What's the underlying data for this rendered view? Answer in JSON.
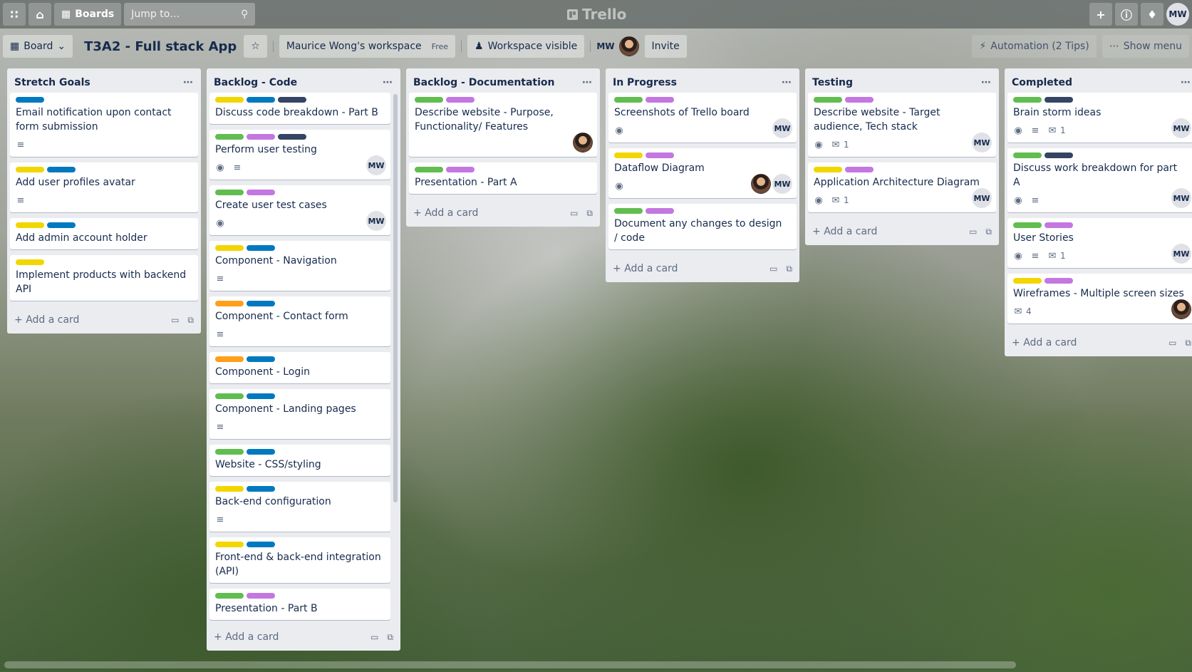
{
  "nav": {
    "boards_label": "Boards",
    "jump_placeholder": "Jump to…",
    "logo_text": "Trello",
    "user_initials": "MW"
  },
  "board": {
    "view_label": "Board",
    "title": "T3A2 - Full stack App",
    "workspace": "Maurice Wong's workspace",
    "plan": "Free",
    "visibility": "Workspace visible",
    "member_initials": "MW",
    "invite_label": "Invite",
    "automation_label": "Automation (2 Tips)",
    "show_menu_label": "Show menu"
  },
  "add_card_label": "Add a card",
  "lists": [
    {
      "title": "Stretch Goals",
      "cards": [
        {
          "labels": [
            "blue"
          ],
          "title": "Email notification upon contact form submission",
          "badges": {
            "desc": true
          }
        },
        {
          "labels": [
            "yellow",
            "blue"
          ],
          "title": "Add user profiles avatar",
          "badges": {
            "desc": true
          }
        },
        {
          "labels": [
            "yellow",
            "blue"
          ],
          "title": "Add admin account holder",
          "badges": {}
        },
        {
          "labels": [
            "yellow"
          ],
          "title": "Implement products with backend API",
          "badges": {}
        }
      ]
    },
    {
      "title": "Backlog - Code",
      "cards": [
        {
          "labels": [
            "yellow",
            "blue",
            "navy"
          ],
          "title": "Discuss code breakdown - Part B",
          "badges": {}
        },
        {
          "labels": [
            "green",
            "purple",
            "navy"
          ],
          "title": "Perform user testing",
          "badges": {
            "watch": true,
            "desc": true
          },
          "members": [
            "MW"
          ]
        },
        {
          "labels": [
            "green",
            "purple"
          ],
          "title": "Create user test cases",
          "badges": {
            "watch": true
          },
          "members": [
            "MW"
          ]
        },
        {
          "labels": [
            "yellow",
            "blue"
          ],
          "title": "Component - Navigation",
          "badges": {
            "desc": true
          }
        },
        {
          "labels": [
            "orange",
            "blue"
          ],
          "title": "Component - Contact form",
          "badges": {
            "desc": true
          }
        },
        {
          "labels": [
            "orange",
            "blue"
          ],
          "title": "Component - Login",
          "badges": {}
        },
        {
          "labels": [
            "green",
            "blue"
          ],
          "title": "Component - Landing pages",
          "badges": {
            "desc": true
          }
        },
        {
          "labels": [
            "green",
            "blue"
          ],
          "title": "Website - CSS/styling",
          "badges": {}
        },
        {
          "labels": [
            "yellow",
            "blue"
          ],
          "title": "Back-end configuration",
          "badges": {
            "desc": true
          }
        },
        {
          "labels": [
            "yellow",
            "blue"
          ],
          "title": "Front-end & back-end integration (API)",
          "badges": {}
        },
        {
          "labels": [
            "green",
            "purple"
          ],
          "title": "Presentation - Part B",
          "badges": {}
        }
      ]
    },
    {
      "title": "Backlog - Documentation",
      "cards": [
        {
          "labels": [
            "green",
            "purple"
          ],
          "title": "Describe website - Purpose, Functionality/ Features",
          "badges": {},
          "members": [
            "photo"
          ]
        },
        {
          "labels": [
            "green",
            "purple"
          ],
          "title": "Presentation - Part A",
          "badges": {}
        }
      ]
    },
    {
      "title": "In Progress",
      "cards": [
        {
          "labels": [
            "green",
            "purple"
          ],
          "title": "Screenshots of Trello board",
          "badges": {
            "watch": true
          },
          "members": [
            "MW"
          ]
        },
        {
          "labels": [
            "yellow",
            "purple"
          ],
          "title": "Dataflow Diagram",
          "badges": {
            "watch": true
          },
          "members": [
            "photo",
            "MW"
          ]
        },
        {
          "labels": [
            "green",
            "purple"
          ],
          "title": "Document any changes to design / code",
          "badges": {}
        }
      ]
    },
    {
      "title": "Testing",
      "cards": [
        {
          "labels": [
            "green",
            "purple"
          ],
          "title": "Describe website - Target audience, Tech stack",
          "badges": {
            "watch": true,
            "comments": "1"
          },
          "members": [
            "MW"
          ]
        },
        {
          "labels": [
            "yellow",
            "purple"
          ],
          "title": "Application Architecture Diagram",
          "badges": {
            "watch": true,
            "comments": "1"
          },
          "members": [
            "MW"
          ]
        }
      ]
    },
    {
      "title": "Completed",
      "cards": [
        {
          "labels": [
            "green",
            "navy"
          ],
          "title": "Brain storm ideas",
          "badges": {
            "watch": true,
            "desc": true,
            "comments": "1"
          },
          "members": [
            "MW"
          ]
        },
        {
          "labels": [
            "green",
            "navy"
          ],
          "title": "Discuss work breakdown for part A",
          "badges": {
            "watch": true,
            "desc": true
          },
          "members": [
            "MW"
          ]
        },
        {
          "labels": [
            "green",
            "purple"
          ],
          "title": "User Stories",
          "badges": {
            "watch": true,
            "desc": true,
            "comments": "1"
          },
          "members": [
            "MW"
          ]
        },
        {
          "labels": [
            "yellow",
            "purple"
          ],
          "title": "Wireframes - Multiple screen sizes",
          "badges": {
            "comments": "4"
          },
          "members": [
            "photo"
          ]
        }
      ]
    }
  ]
}
